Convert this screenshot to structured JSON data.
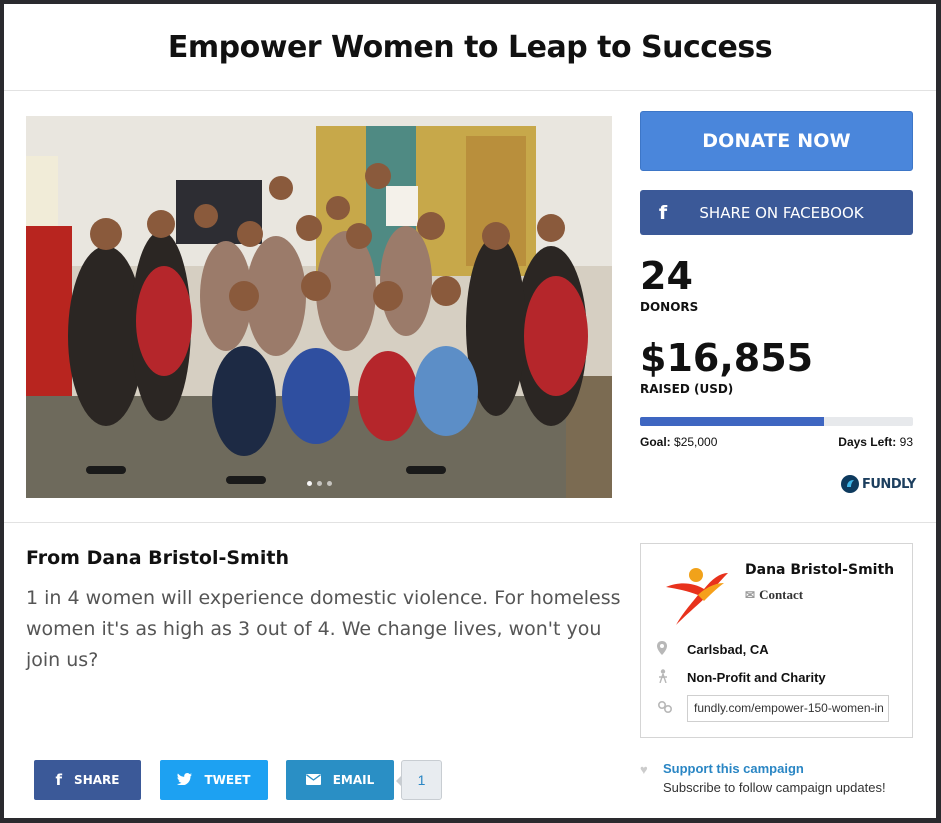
{
  "campaign": {
    "title": "Empower Women to Leap to Success"
  },
  "actions": {
    "donate_label": "DONATE NOW",
    "facebook_label": "SHARE ON FACEBOOK"
  },
  "stats": {
    "donors_count": "24",
    "donors_label": "DONORS",
    "raised_amount": "$16,855",
    "raised_label": "RAISED (USD)",
    "progress_percent": 67.4,
    "goal_label": "Goal:",
    "goal_value": "$25,000",
    "days_left_label": "Days Left:",
    "days_left_value": "93"
  },
  "branding": {
    "logo_text": "FUNDLY"
  },
  "story": {
    "heading": "From Dana Bristol-Smith",
    "text": "1 in 4 women will experience domestic violence. For homeless women it's as high as 3 out of 4. We change lives, won't you join us?"
  },
  "organizer": {
    "name": "Dana Bristol-Smith",
    "contact_label": "Contact",
    "location": "Carlsbad, CA",
    "category": "Non-Profit and Charity",
    "url": "fundly.com/empower-150-women-in"
  },
  "support": {
    "link_label": "Support this campaign",
    "subtext": "Subscribe to follow campaign updates!"
  },
  "share_bar": {
    "share_label": "SHARE",
    "tweet_label": "TWEET",
    "email_label": "EMAIL",
    "share_count": "1"
  },
  "colors": {
    "donate": "#4a86db",
    "facebook": "#3b5998",
    "twitter": "#1da1f2",
    "email": "#2a8fc5",
    "progress": "#3e66c1",
    "link": "#2a86c4"
  }
}
